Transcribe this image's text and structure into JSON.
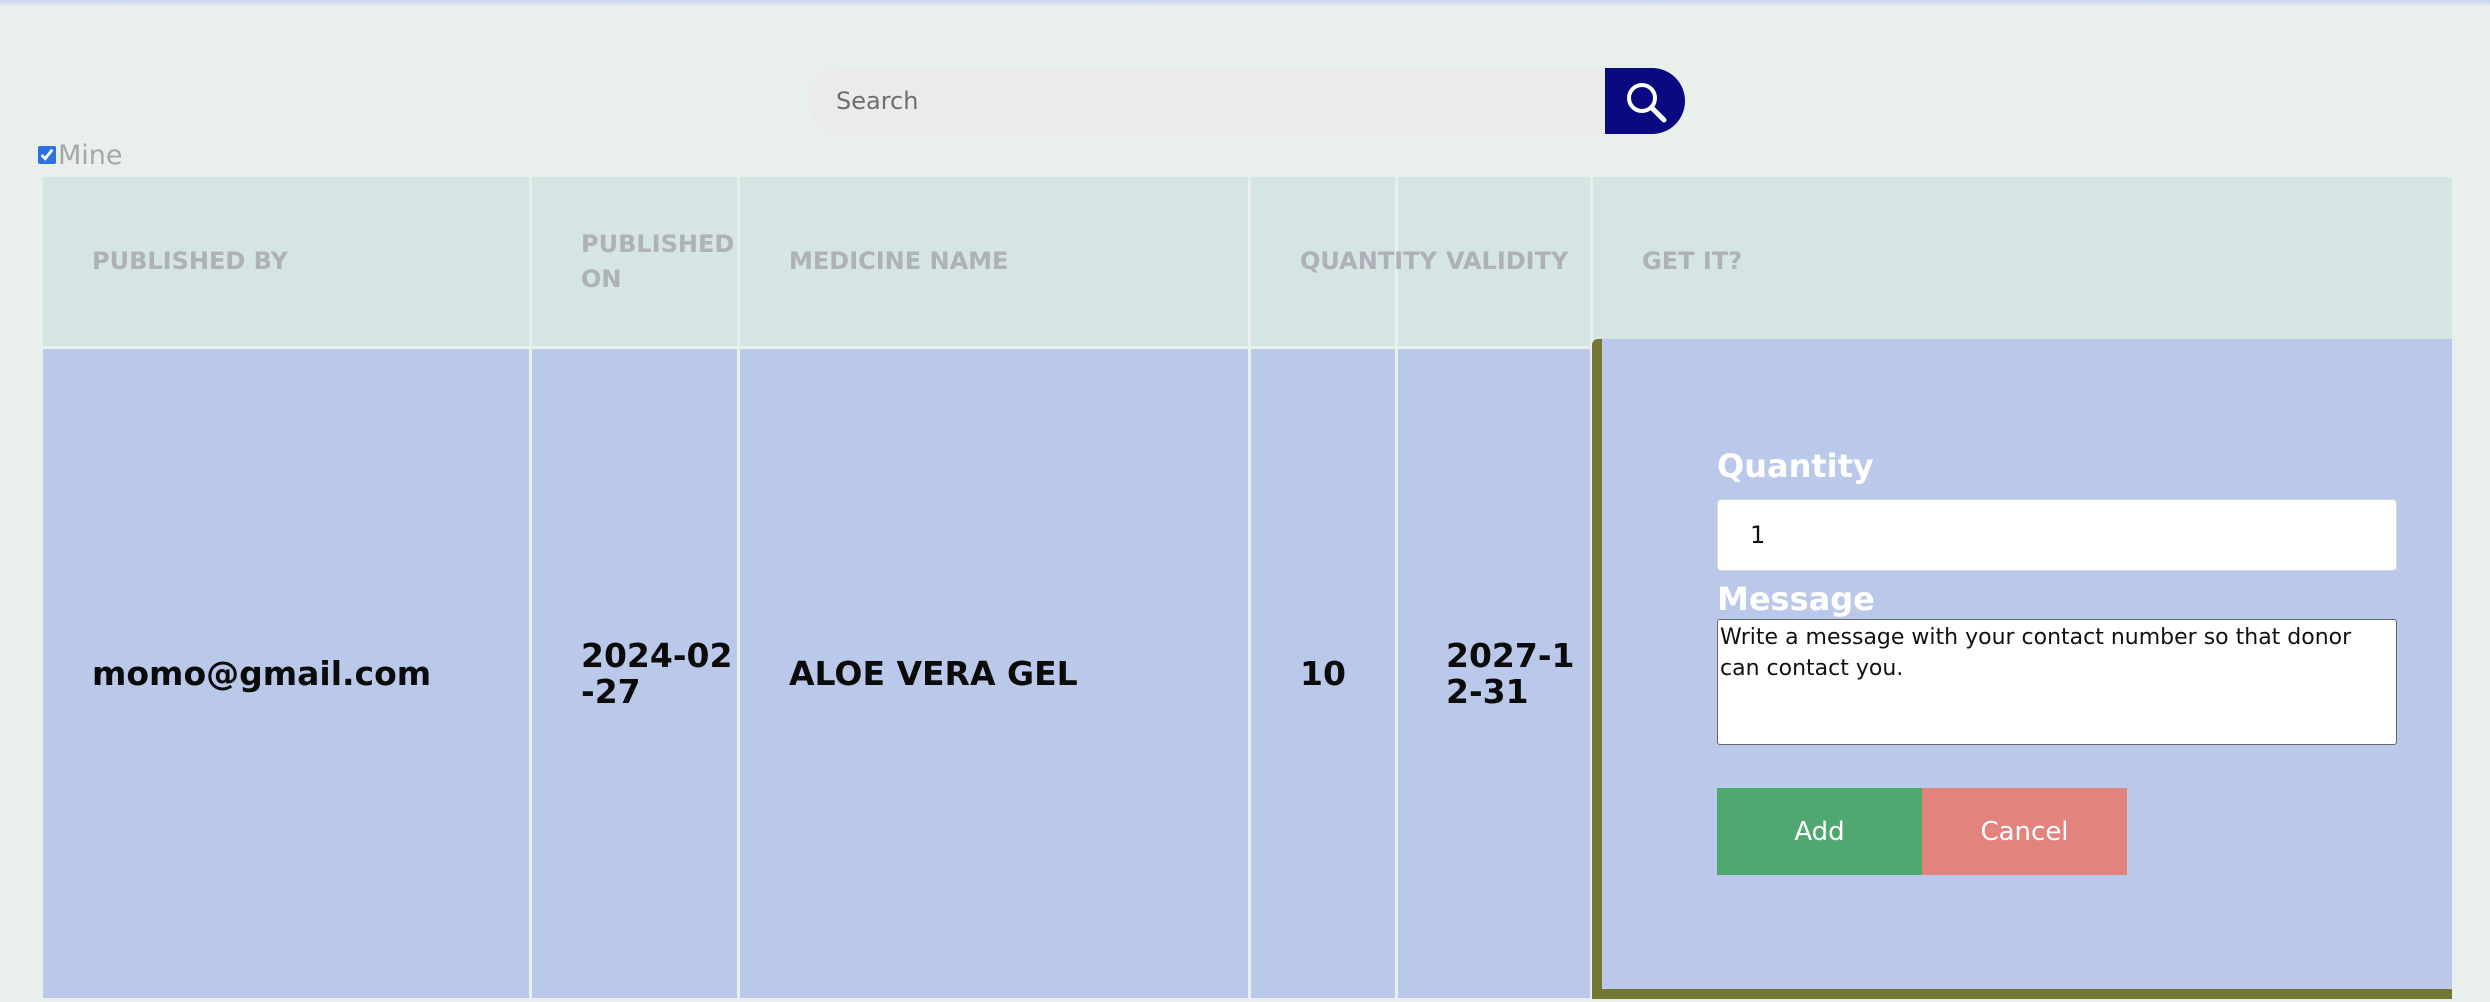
{
  "search": {
    "placeholder": "Search",
    "icon": "search-icon"
  },
  "filter": {
    "mine_label": "Mine",
    "mine_checked": true
  },
  "table": {
    "headers": [
      "PUBLISHED BY",
      "PUBLISHED ON",
      "MEDICINE NAME",
      "QUANTITY",
      "VALIDITY",
      "GET IT?"
    ],
    "rows": [
      {
        "published_by": "momo@gmail.com",
        "published_on": "2024-02-27",
        "medicine_name": "ALOE VERA GEL",
        "quantity": "10",
        "validity": "2027-12-31"
      }
    ]
  },
  "request_form": {
    "quantity_label": "Quantity",
    "quantity_value": "1",
    "message_label": "Message",
    "message_placeholder": "Write a message with your contact number so that donor can contact you.",
    "add_label": "Add",
    "cancel_label": "Cancel"
  },
  "colors": {
    "search_button": "#0a0a80",
    "header_bg": "#d5e5e4",
    "row_bg": "#bac8ea",
    "panel_border": "#737533",
    "add_button": "#4ea86f",
    "cancel_button": "#e3837e"
  }
}
